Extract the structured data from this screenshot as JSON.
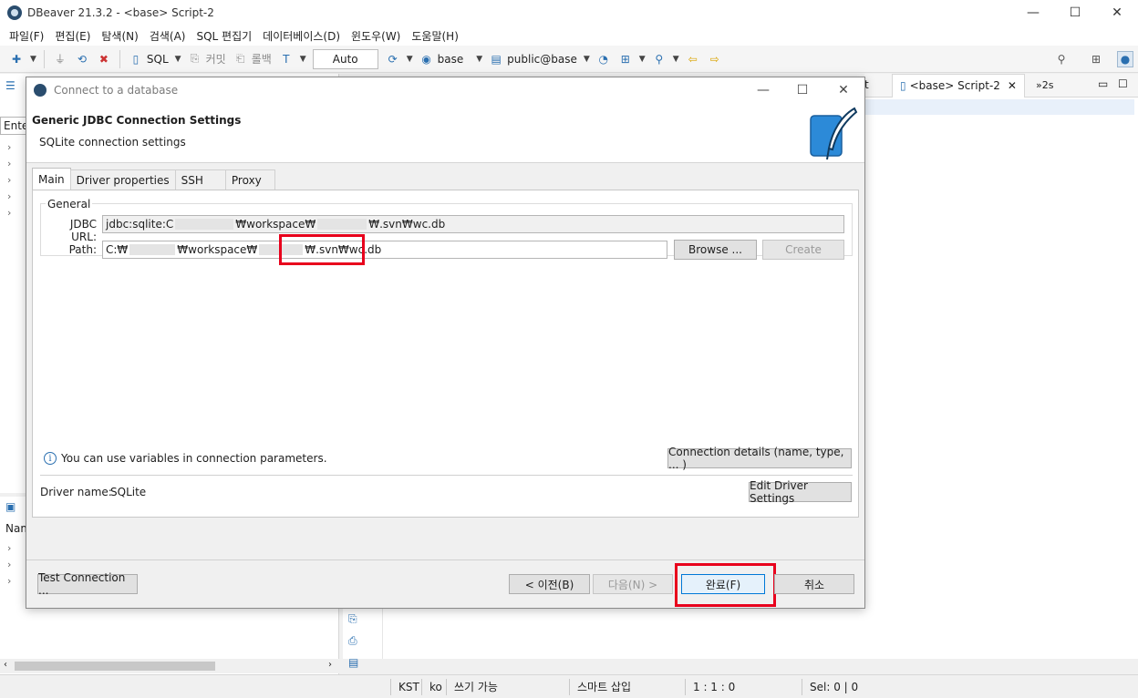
{
  "window": {
    "title": "DBeaver 21.3.2 - <base> Script-2",
    "minimize": "—",
    "maximize": "☐",
    "close": "✕"
  },
  "menu": [
    "파일(F)",
    "편집(E)",
    "탐색(N)",
    "검색(A)",
    "SQL 편집기",
    "데이터베이스(D)",
    "윈도우(W)",
    "도움말(H)"
  ],
  "toolbar": {
    "sql_label": "SQL",
    "commit_label": "커밋",
    "rollback_label": "롤백",
    "auto_label": "Auto",
    "datasource_label": "base",
    "schema_label": "public@base"
  },
  "editor": {
    "tab_fragment": "t",
    "tab_label": "<base> Script-2",
    "overflow_label": "»2s"
  },
  "left_pane": {
    "filter_placeholder": "Ente",
    "name_header": "Nam"
  },
  "dialog": {
    "title": "Connect to a database",
    "header_title": "Generic JDBC Connection Settings",
    "header_subtitle": "SQLite connection settings",
    "tabs": [
      "Main",
      "Driver properties",
      "SSH",
      "Proxy"
    ],
    "active_tab": "Main",
    "group_label": "General",
    "jdbc_url_label": "JDBC URL:",
    "jdbc_url_parts": [
      "jdbc:sqlite:C",
      "₩workspace₩",
      "₩.svn₩wc.db"
    ],
    "path_label": "Path:",
    "path_parts": [
      "C:₩",
      "₩workspace₩",
      "₩.svn₩wc.db"
    ],
    "browse_label": "Browse ...",
    "create_label": "Create",
    "variables_hint": "You can use variables in connection parameters.",
    "connection_details_label": "Connection details (name, type, ... )",
    "driver_name_label": "Driver name:",
    "driver_name_value": "SQLite",
    "edit_driver_label": "Edit Driver Settings",
    "test_connection_label": "Test Connection ...",
    "back_label": "< 이전(B)",
    "next_label": "다음(N) >",
    "finish_label": "완료(F)",
    "cancel_label": "취소"
  },
  "statusbar": {
    "timezone": "KST",
    "locale": "ko",
    "write_mode": "쓰기 가능",
    "insert_mode": "스마트 삽입",
    "position": "1 : 1 : 0",
    "selection": "Sel: 0 | 0"
  },
  "colors": {
    "highlight_border": "#e8001c",
    "accent": "#0078d7"
  }
}
